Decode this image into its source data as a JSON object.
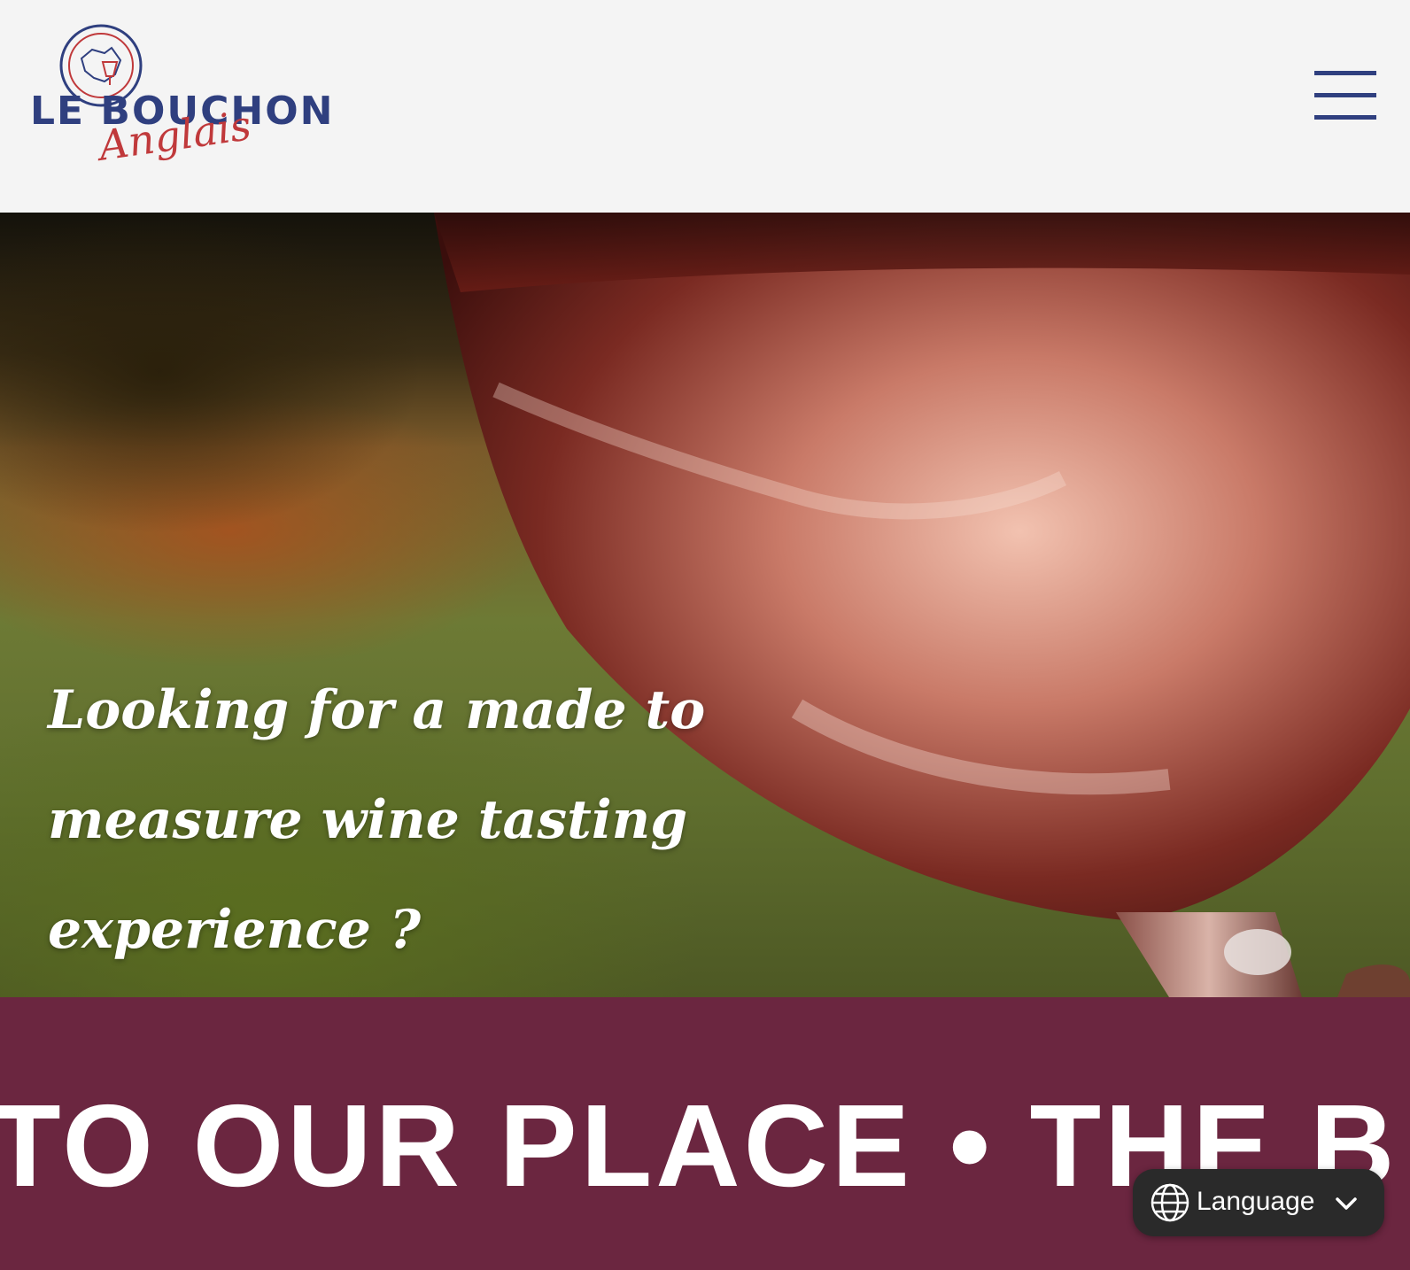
{
  "header": {
    "logo": {
      "title": "LE BOUCHON",
      "script": "Anglais",
      "emblem_icon": "wine-glass-map-emblem"
    },
    "menu_icon": "hamburger-menu-icon"
  },
  "hero": {
    "heading": "Looking for a made to measure wine tasting experience ?"
  },
  "band": {
    "marquee_text": "TO OUR PLACE • THE B"
  },
  "language_switcher": {
    "label": "Language",
    "icon": "globe-icon",
    "chevron": "chevron-down-icon"
  },
  "colors": {
    "brand_blue": "#2f3f7f",
    "brand_red": "#c0393b",
    "band_burgundy": "#6b2640",
    "header_bg": "#f4f4f4",
    "language_button_bg": "#2a2a2a"
  }
}
